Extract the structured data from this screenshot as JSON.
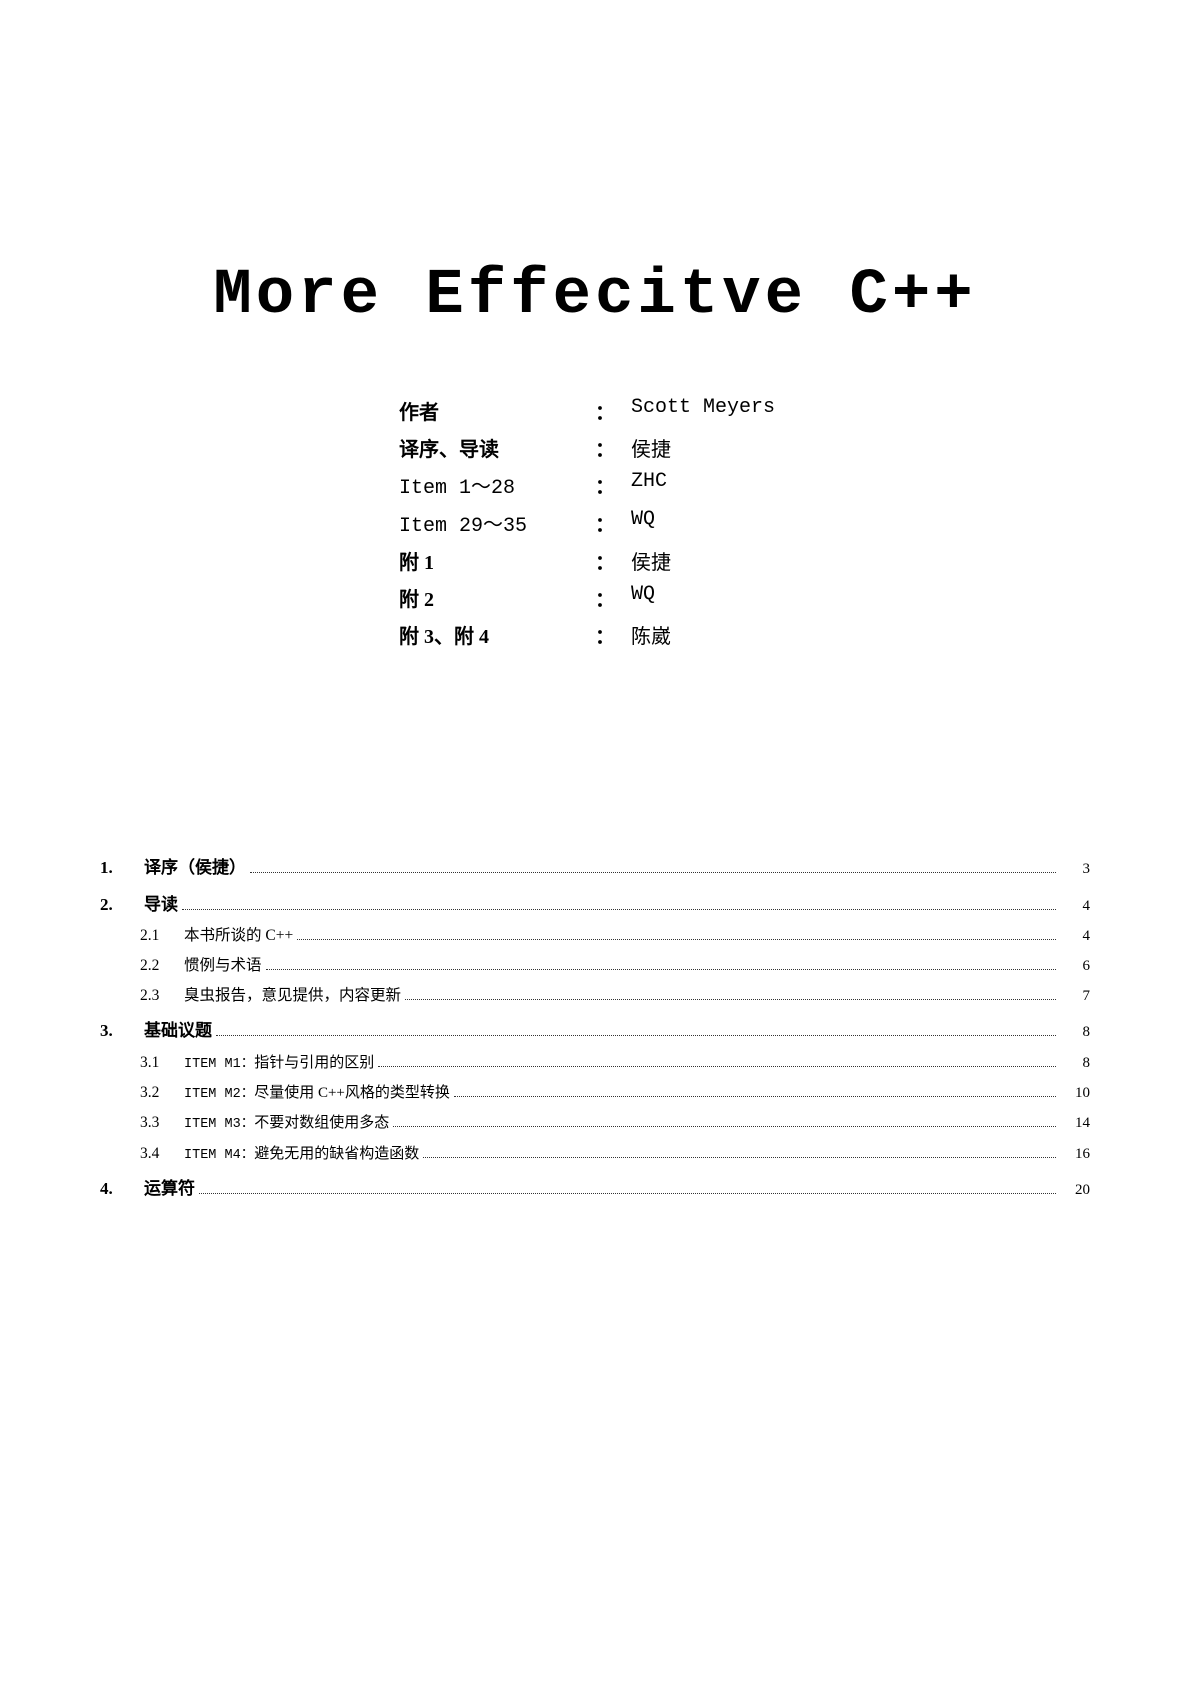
{
  "title": "More  Effecitve  C++",
  "info_rows": [
    {
      "label": "作者",
      "label_type": "cn",
      "colon": "：",
      "value": "Scott Meyers",
      "value_type": "mono"
    },
    {
      "label": "译序、导读",
      "label_type": "cn",
      "colon": "：",
      "value": "侯捷",
      "value_type": "cn"
    },
    {
      "label": "Item  1～28",
      "label_type": "mono",
      "colon": "：",
      "value": "ZHC",
      "value_type": "mono"
    },
    {
      "label": "Item 29～35",
      "label_type": "mono",
      "colon": "：",
      "value": "WQ",
      "value_type": "mono"
    },
    {
      "label": "附 1",
      "label_type": "cn",
      "colon": "：",
      "value": "侯捷",
      "value_type": "cn"
    },
    {
      "label": "附 2",
      "label_type": "cn",
      "colon": "：",
      "value": "WQ",
      "value_type": "mono"
    },
    {
      "label": "附 3、附 4",
      "label_type": "cn",
      "colon": "：",
      "value": "陈崴",
      "value_type": "cn"
    }
  ],
  "toc": {
    "entries": [
      {
        "num": "1.",
        "label": "译序（侯捷）",
        "label_type": "cn",
        "page": "3",
        "level": "main"
      },
      {
        "num": "2.",
        "label": "导读",
        "label_type": "cn",
        "page": "4",
        "level": "main"
      },
      {
        "num": "2.1",
        "label": "本书所谈的 C++",
        "label_type": "cn",
        "page": "4",
        "level": "sub"
      },
      {
        "num": "2.2",
        "label": "惯例与术语",
        "label_type": "cn",
        "page": "6",
        "level": "sub"
      },
      {
        "num": "2.3",
        "label": "臭虫报告，意见提供，内容更新",
        "label_type": "cn",
        "page": "7",
        "level": "sub"
      },
      {
        "num": "3.",
        "label": "基础议题",
        "label_type": "cn",
        "page": "8",
        "level": "main"
      },
      {
        "num": "3.1",
        "label": "ITEM M1：指针与引用的区别",
        "label_type": "item",
        "page": "8",
        "level": "sub"
      },
      {
        "num": "3.2",
        "label": "ITEM M2：尽量使用 C++风格的类型转换",
        "label_type": "item",
        "page": "10",
        "level": "sub"
      },
      {
        "num": "3.3",
        "label": "ITEM M3：不要对数组使用多态",
        "label_type": "item",
        "page": "14",
        "level": "sub"
      },
      {
        "num": "3.4",
        "label": "ITEM M4：避免无用的缺省构造函数",
        "label_type": "item",
        "page": "16",
        "level": "sub"
      },
      {
        "num": "4.",
        "label": "运算符",
        "label_type": "cn",
        "page": "20",
        "level": "main"
      }
    ]
  }
}
